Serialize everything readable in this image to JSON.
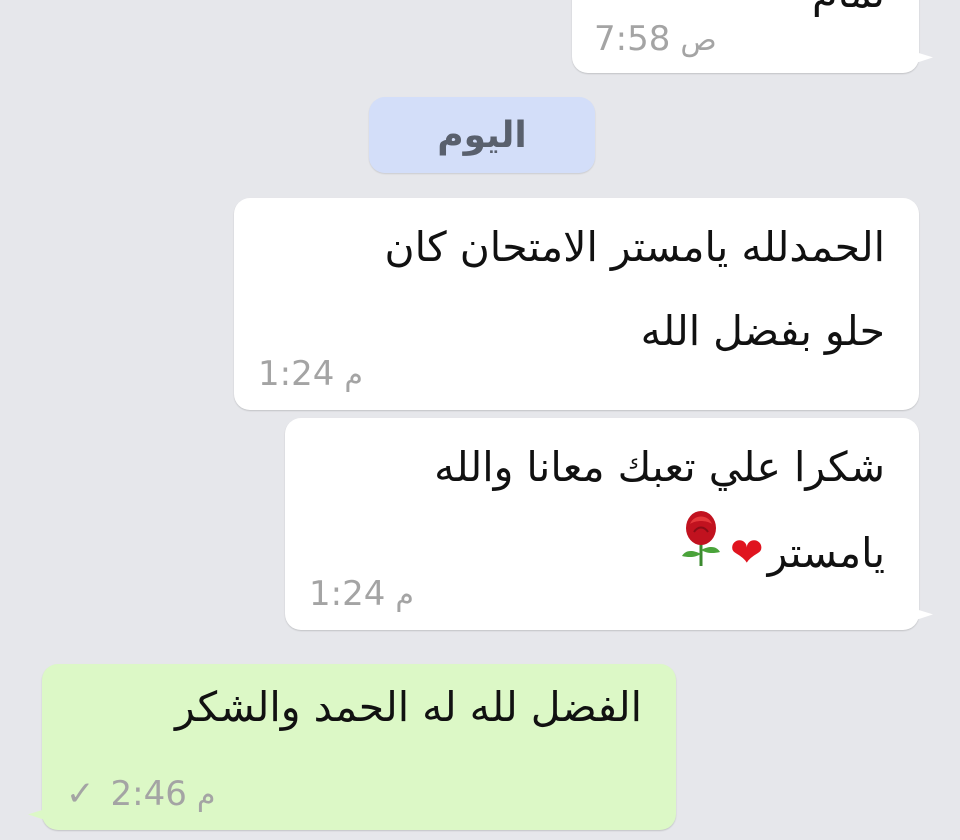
{
  "messages": [
    {
      "direction": "incoming",
      "text_lines": [
        "تمام"
      ],
      "time": "7:58",
      "ampm": "ص"
    },
    {
      "direction": "incoming",
      "text_lines": [
        "الحمدلله يامستر الامتحان كان",
        "حلو بفضل الله"
      ],
      "time": "1:24",
      "ampm": "م"
    },
    {
      "direction": "incoming",
      "text_lines": [
        "شكرا علي تعبك معانا والله",
        "يامستر"
      ],
      "emoji": [
        "heart-emoji",
        "rose-emoji"
      ],
      "time": "1:24",
      "ampm": "م"
    },
    {
      "direction": "outgoing",
      "text_lines": [
        "الفضل لله له الحمد والشكر"
      ],
      "time": "2:46",
      "ampm": "م",
      "status_icon": "single-check-icon"
    }
  ],
  "date_separator": {
    "label": "اليوم"
  },
  "colors": {
    "background": "#e6e7eb",
    "incoming_bubble": "#ffffff",
    "outgoing_bubble": "#dcf8c6",
    "date_chip": "#d3def9",
    "meta_text": "#a4a4a4"
  }
}
